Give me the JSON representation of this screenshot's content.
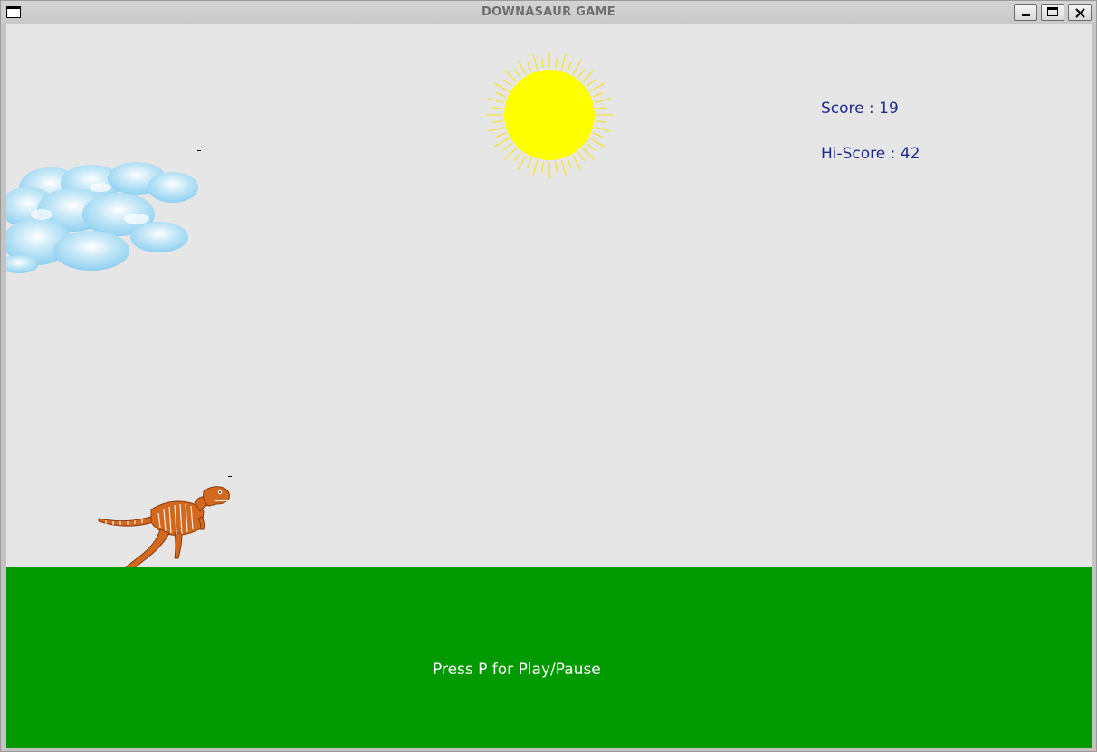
{
  "window": {
    "title": "DOWNASAUR GAME"
  },
  "hud": {
    "score_text": "Score : 19",
    "score": 19,
    "hiscore_text": "Hi-Score : 42",
    "hiscore": 42
  },
  "ground": {
    "hint": "Press P for Play/Pause"
  },
  "colors": {
    "sky": "#e6e6e6",
    "ground": "#009a00",
    "sun": "#ffff00",
    "sun_rays": "#f2e23a",
    "hud_text": "#1c2a8c",
    "hint_text": "#ffffff",
    "dino": "#d2691e",
    "cloud": "#9ed6f2"
  },
  "icons": {
    "window_menu": "window-menu-icon",
    "minimize": "minimize-icon",
    "maximize": "maximize-icon",
    "close": "close-icon",
    "sun": "sun-icon",
    "cloud": "cloud-icon",
    "dinosaur": "dinosaur-skeleton-icon"
  }
}
